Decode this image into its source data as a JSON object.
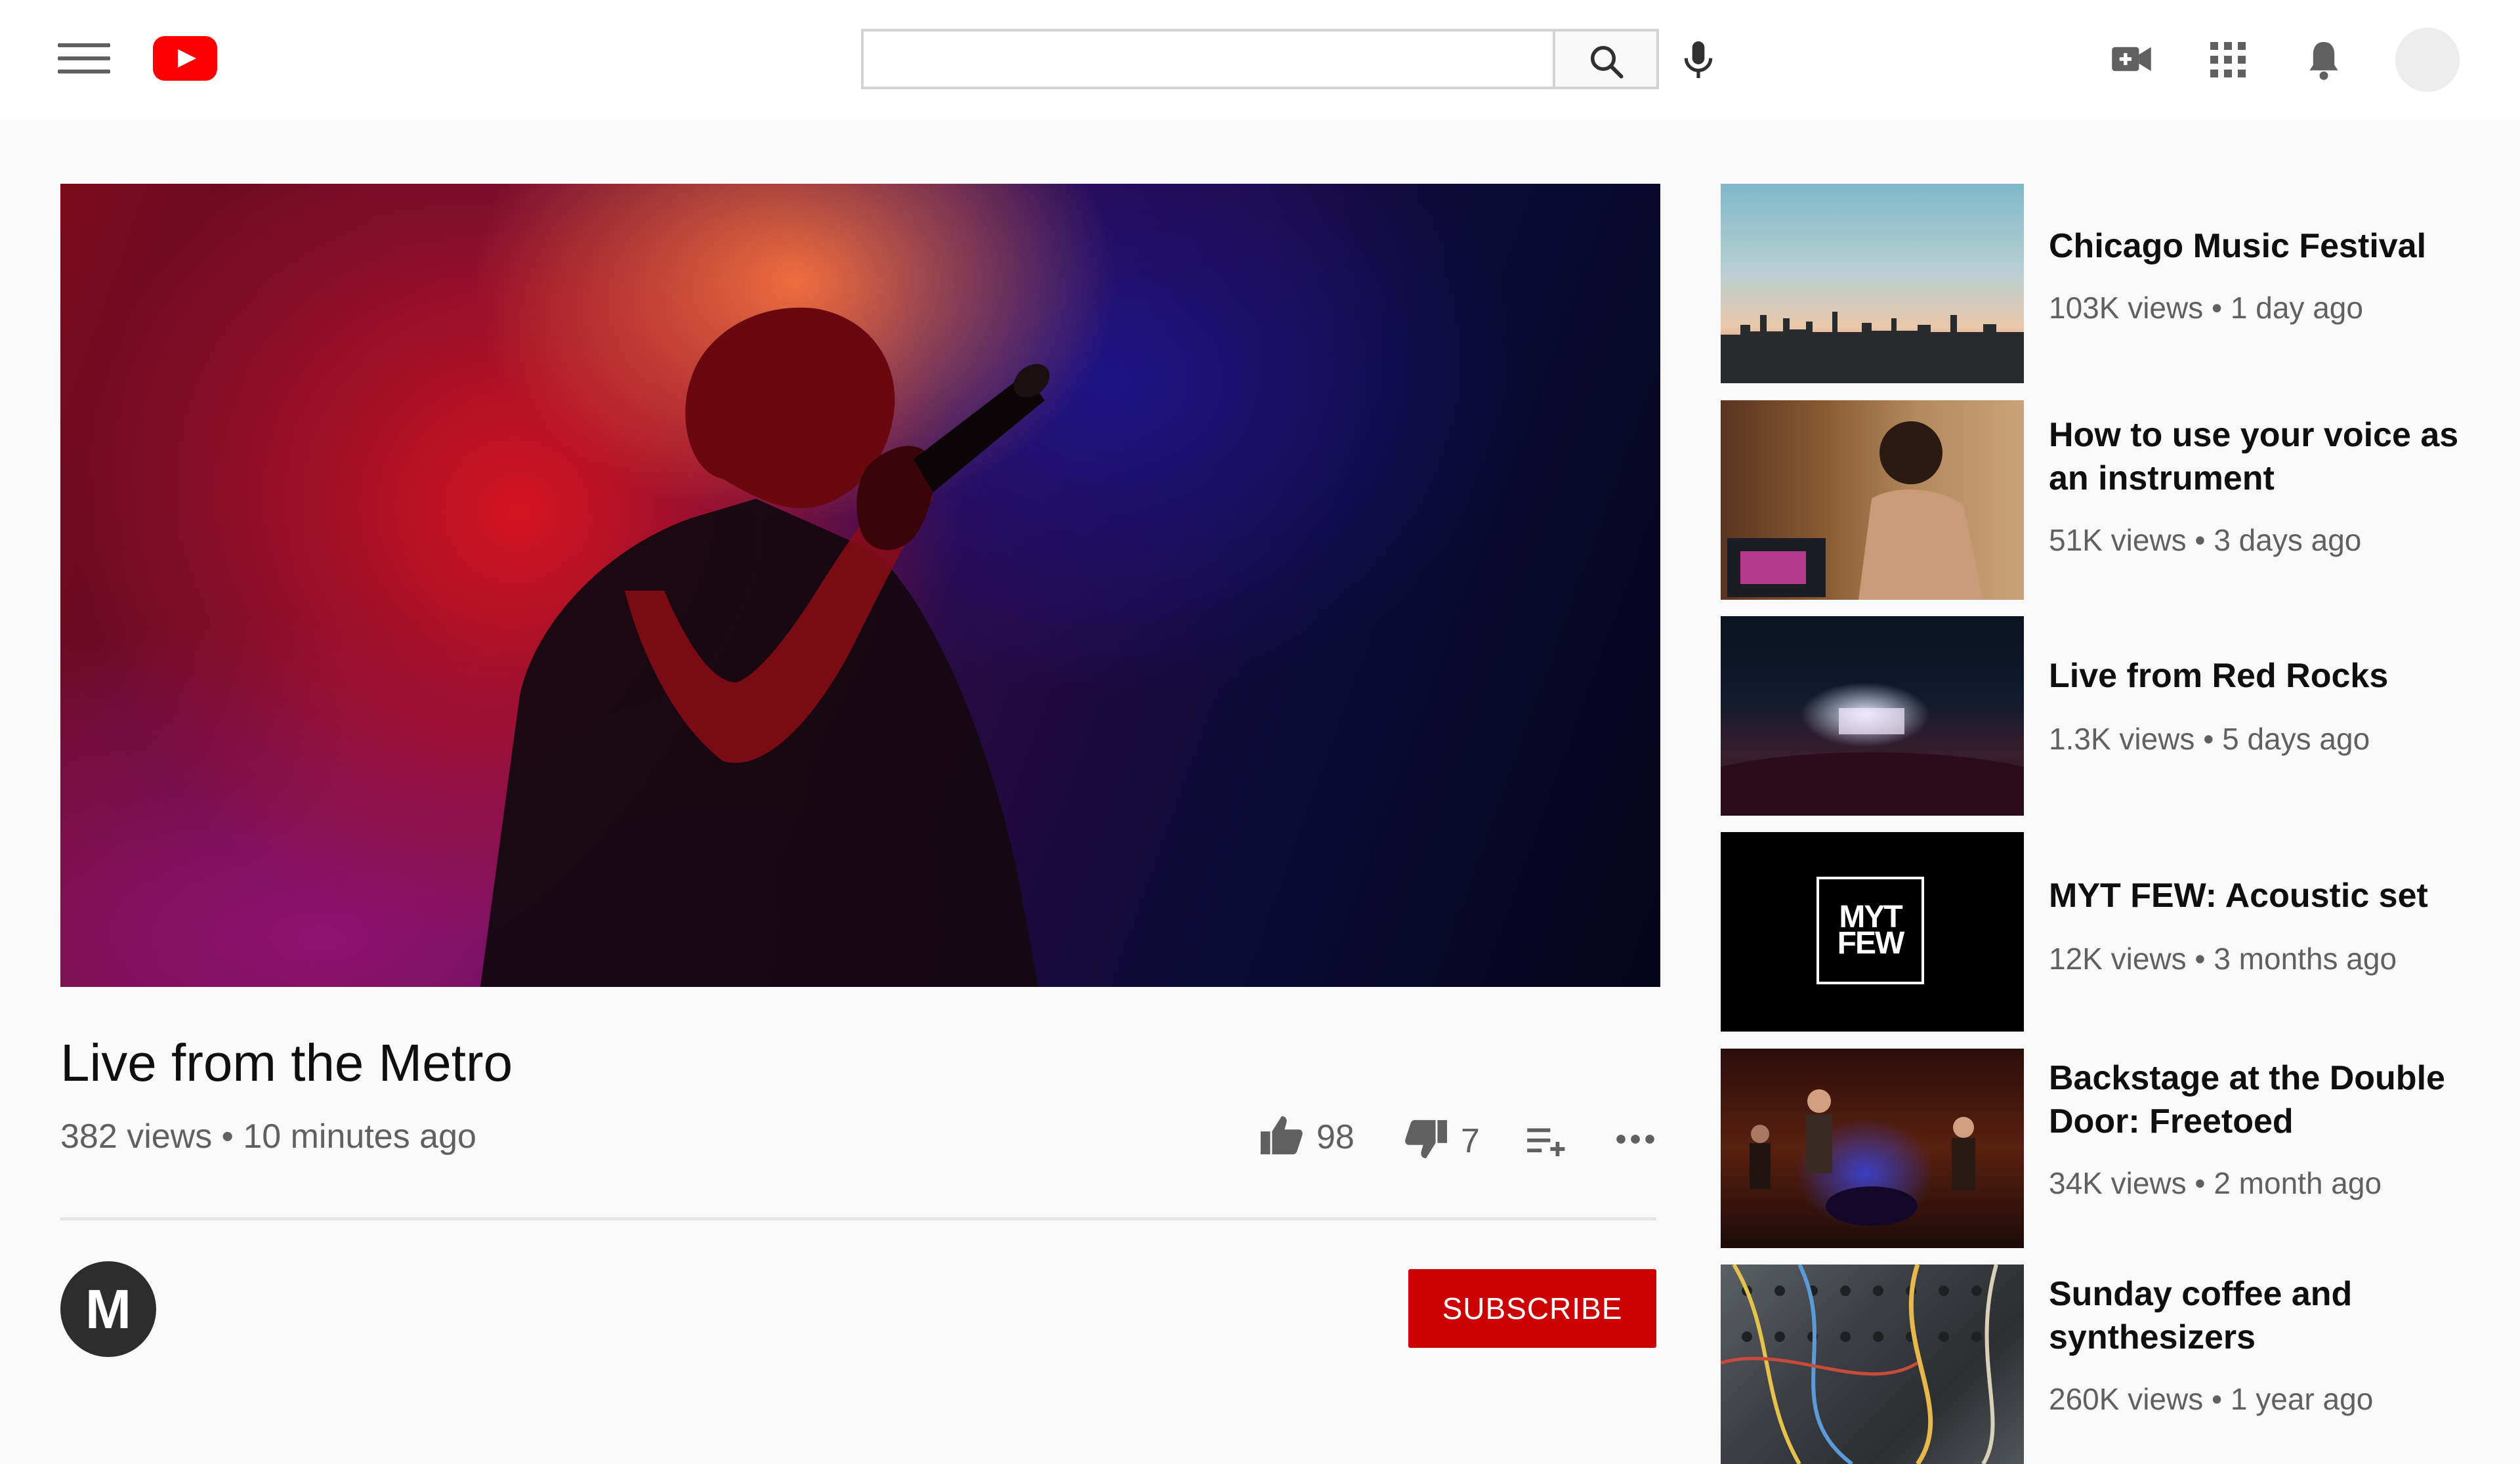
{
  "header": {
    "search_placeholder": "",
    "colors": {
      "brand": "#ff0000",
      "icon": "#606060"
    },
    "icons": [
      "menu-icon",
      "youtube-logo",
      "search-icon",
      "microphone-icon",
      "create-video-icon",
      "apps-grid-icon",
      "notifications-bell-icon",
      "account-avatar"
    ]
  },
  "video": {
    "title": "Live from the Metro",
    "meta": "382 views • 10 minutes ago",
    "likes": "98",
    "dislikes": "7"
  },
  "channel": {
    "avatar_letter": "M",
    "subscribe_label": "SUBSCRIBE",
    "colors": {
      "subscribe": "#cc0000",
      "avatar": "#2d2d2d"
    }
  },
  "recommendations": [
    {
      "title": "Chicago Music Festival",
      "meta": "103K views • 1 day ago"
    },
    {
      "title": "How to use your voice as an instrument",
      "meta": "51K views • 3 days ago"
    },
    {
      "title": "Live from Red Rocks",
      "meta": "1.3K views • 5 days ago"
    },
    {
      "title": "MYT FEW: Acoustic set",
      "meta": "12K views • 3 months ago",
      "thumb_logo_line1": "MYT",
      "thumb_logo_line2": "FEW"
    },
    {
      "title": "Backstage at the Double Door: Freetoed",
      "meta": "34K views • 2 month ago"
    },
    {
      "title": "Sunday coffee and synthesizers",
      "meta": "260K views • 1 year ago"
    }
  ]
}
